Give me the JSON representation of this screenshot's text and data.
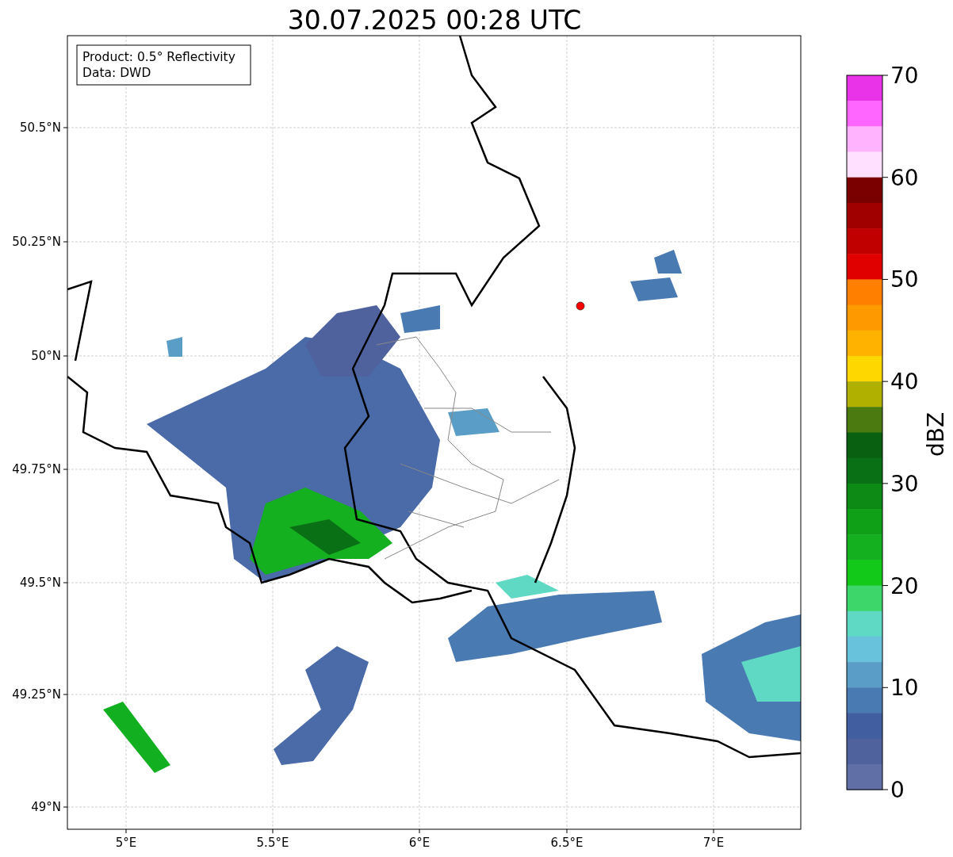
{
  "chart_title": "30.07.2025 00:28 UTC",
  "legend": {
    "lines": [
      "Product: 0.5° Reflectivity",
      "Data: DWD"
    ]
  },
  "map": {
    "y_tick_labels": [
      "50.5°N",
      "50.25°N",
      "50°N",
      "49.75°N",
      "49.5°N",
      "49.25°N",
      "49°N"
    ],
    "x_tick_labels": [
      "5°E",
      "5.5°E",
      "6°E",
      "6.5°E",
      "7°E"
    ]
  },
  "colorbar": {
    "label": "dBZ",
    "tick_labels": [
      "70",
      "60",
      "50",
      "40",
      "30",
      "20",
      "10",
      "0"
    ],
    "segments": [
      {
        "color": "#e833e8"
      },
      {
        "color": "#ff66ff"
      },
      {
        "color": "#ffb3ff"
      },
      {
        "color": "#ffe0ff"
      },
      {
        "color": "#7a0000"
      },
      {
        "color": "#a00000"
      },
      {
        "color": "#c00000"
      },
      {
        "color": "#e00000"
      },
      {
        "color": "#ff7f00"
      },
      {
        "color": "#ff9900"
      },
      {
        "color": "#ffb300"
      },
      {
        "color": "#ffd700"
      },
      {
        "color": "#b0b000"
      },
      {
        "color": "#4a7a10"
      },
      {
        "color": "#086010"
      },
      {
        "color": "#0a7015"
      },
      {
        "color": "#0c8a15"
      },
      {
        "color": "#10a018"
      },
      {
        "color": "#14b020"
      },
      {
        "color": "#12c818"
      },
      {
        "color": "#3cd66a"
      },
      {
        "color": "#5fd8c4"
      },
      {
        "color": "#68c2dc"
      },
      {
        "color": "#5a9ec8"
      },
      {
        "color": "#4a7ab2"
      },
      {
        "color": "#405ea0"
      },
      {
        "color": "#50629e"
      },
      {
        "color": "#6070a6"
      }
    ]
  }
}
